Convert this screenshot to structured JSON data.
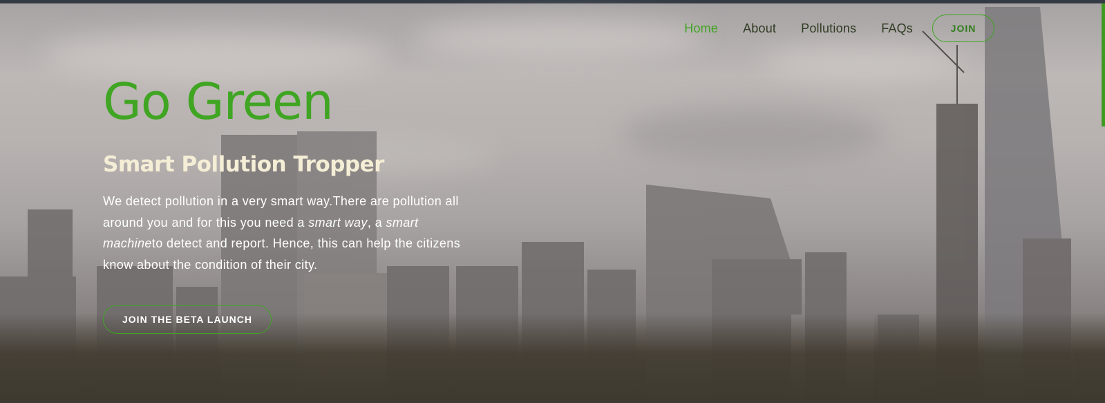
{
  "nav": {
    "items": [
      {
        "label": "Home",
        "active": true
      },
      {
        "label": "About",
        "active": false
      },
      {
        "label": "Pollutions",
        "active": false
      },
      {
        "label": "FAQs",
        "active": false
      }
    ],
    "join_label": "JOIN"
  },
  "hero": {
    "title": "Go Green",
    "subtitle": "Smart Pollution Tropper",
    "description": {
      "part1": "We detect pollution in a very smart way.There are pollution all around you and for this you need a ",
      "em1": "smart way",
      "part2": ", a ",
      "em2": "smart machine",
      "part3": "to detect and report. Hence, this can help the citizens know about the condition of their city."
    },
    "cta_label": "JOIN THE BETA LAUNCH"
  },
  "colors": {
    "accent": "#3fa522",
    "subtitle": "#f5eed6",
    "topbar": "#343a44"
  },
  "background": {
    "icon": "city-skyline-photo"
  }
}
